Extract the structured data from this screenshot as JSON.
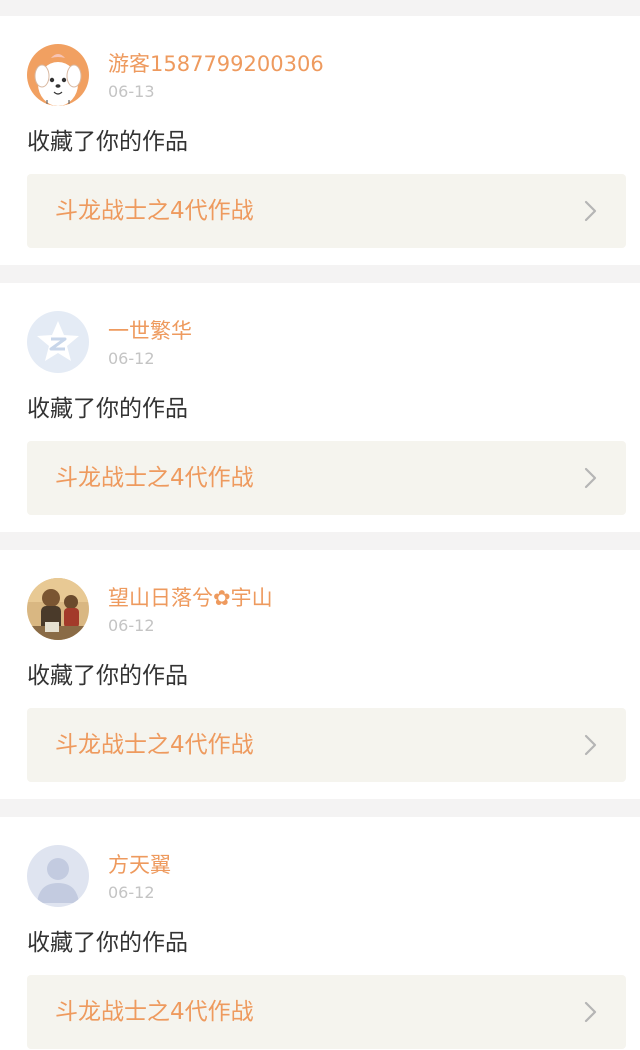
{
  "notifications": [
    {
      "username": "游客1587799200306",
      "date": "06-13",
      "action": "收藏了你的作品",
      "work_title": "斗龙战士之4代作战",
      "avatar_icon": "cartoon-dog-avatar"
    },
    {
      "username": "一世繁华",
      "date": "06-12",
      "action": "收藏了你的作品",
      "work_title": "斗龙战士之4代作战",
      "avatar_icon": "qzone-star-avatar"
    },
    {
      "username": "望山日落兮✿宇山",
      "date": "06-12",
      "action": "收藏了你的作品",
      "work_title": "斗龙战士之4代作战",
      "avatar_icon": "photo-avatar"
    },
    {
      "username": "方天翼",
      "date": "06-12",
      "action": "收藏了你的作品",
      "work_title": "斗龙战士之4代作战",
      "avatar_icon": "default-person-avatar"
    }
  ],
  "colors": {
    "accent": "#ee9a5e",
    "date": "#c4c4c4",
    "text": "#333333",
    "link_bg": "#f5f4ee",
    "page_bg": "#f4f3f3"
  }
}
